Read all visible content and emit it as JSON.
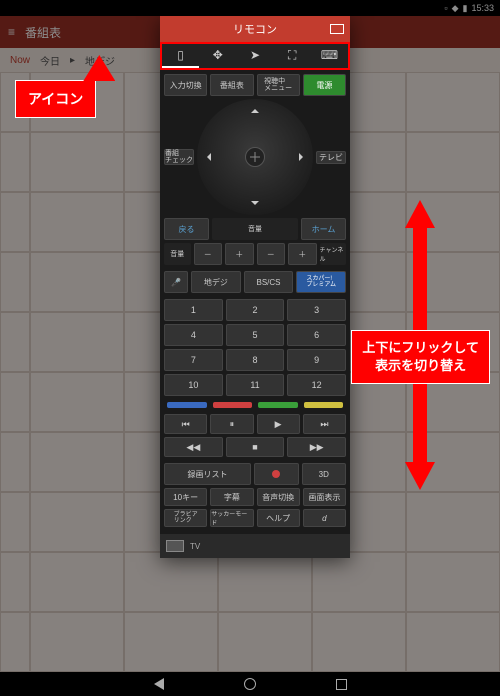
{
  "status": {
    "time": "15:33"
  },
  "app": {
    "title": "番組表"
  },
  "sub": {
    "now": "Now",
    "today": "今日",
    "source": "地デジ"
  },
  "remote": {
    "title": "リモコン",
    "row1": {
      "input": "入力切換",
      "guide": "番組表",
      "menu": "視聴中\nメニュー",
      "power": "電源"
    },
    "side": {
      "check": "番組\nチェック",
      "tv": "テレビ"
    },
    "row2": {
      "back": "戻る",
      "home": "ホーム"
    },
    "row3": {
      "vol": "音量",
      "mute": "音量",
      "ch": "チャンネル"
    },
    "minus": "－",
    "plus": "＋",
    "row4": {
      "digi": "地デジ",
      "bscs": "BS/CS",
      "skyper": "スカパー!\nプレミアム"
    },
    "nums": [
      "1",
      "2",
      "3",
      "4",
      "5",
      "6",
      "7",
      "8",
      "9",
      "10",
      "11",
      "12"
    ],
    "reclist": "録画リスト",
    "threeD": "3D",
    "bottom": {
      "tenkey": "10キー",
      "subtitle": "字幕",
      "audio": "音声切換",
      "display": "画面表示"
    },
    "bottom2": {
      "bravia": "ブラビア\nリンク",
      "soccer": "サッカーモード",
      "help": "ヘルプ",
      "d": "d"
    },
    "footer": "TV"
  },
  "callouts": {
    "icon": "アイコン",
    "flick1": "上下にフリックして",
    "flick2": "表示を切り替え"
  }
}
